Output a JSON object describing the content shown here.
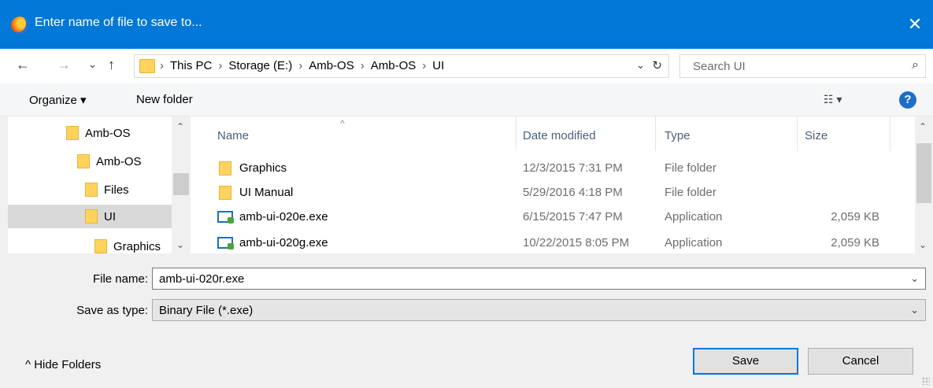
{
  "window": {
    "title": "Enter name of file to save to...",
    "close_glyph": "✕"
  },
  "nav": {
    "back": "←",
    "forward": "→",
    "recent": "⌄",
    "up": "↑"
  },
  "address": {
    "crumbs": [
      "This PC",
      "Storage (E:)",
      "Amb-OS",
      "Amb-OS",
      "UI"
    ],
    "dropdown_glyph": "⌄",
    "refresh_glyph": "↻"
  },
  "search": {
    "placeholder": "Search UI",
    "icon": "⌕"
  },
  "toolbar": {
    "organize": "Organize ▾",
    "new_folder": "New folder",
    "views": "☷ ▾",
    "help": "?"
  },
  "navpane": {
    "items": [
      "Amb-OS",
      "Amb-OS",
      "Files",
      "UI",
      "Graphics"
    ],
    "selected": "UI"
  },
  "filelist": {
    "columns": [
      "Name",
      "Date modified",
      "Type",
      "Size"
    ],
    "sort_glyph": "^",
    "rows": [
      {
        "name": "Graphics",
        "date": "12/3/2015 7:31 PM",
        "type": "File folder",
        "size": "",
        "kind": "folder"
      },
      {
        "name": "UI Manual",
        "date": "5/29/2016 4:18 PM",
        "type": "File folder",
        "size": "",
        "kind": "folder"
      },
      {
        "name": "amb-ui-020e.exe",
        "date": "6/15/2015 7:47 PM",
        "type": "Application",
        "size": "2,059 KB",
        "kind": "app"
      },
      {
        "name": "amb-ui-020g.exe",
        "date": "10/22/2015 8:05 PM",
        "type": "Application",
        "size": "2,059 KB",
        "kind": "app"
      }
    ]
  },
  "form": {
    "filename_label": "File name:",
    "filename_value": "amb-ui-020r.exe",
    "savetype_label": "Save as type:",
    "savetype_value": "Binary File (*.exe)",
    "chevron": "⌄"
  },
  "footer": {
    "hide_folders": "^  Hide Folders",
    "save": "Save",
    "cancel": "Cancel"
  },
  "colors": {
    "titlebar": "#0078d7",
    "selection": "#d9d9d9",
    "folder": "#ffd35c"
  }
}
